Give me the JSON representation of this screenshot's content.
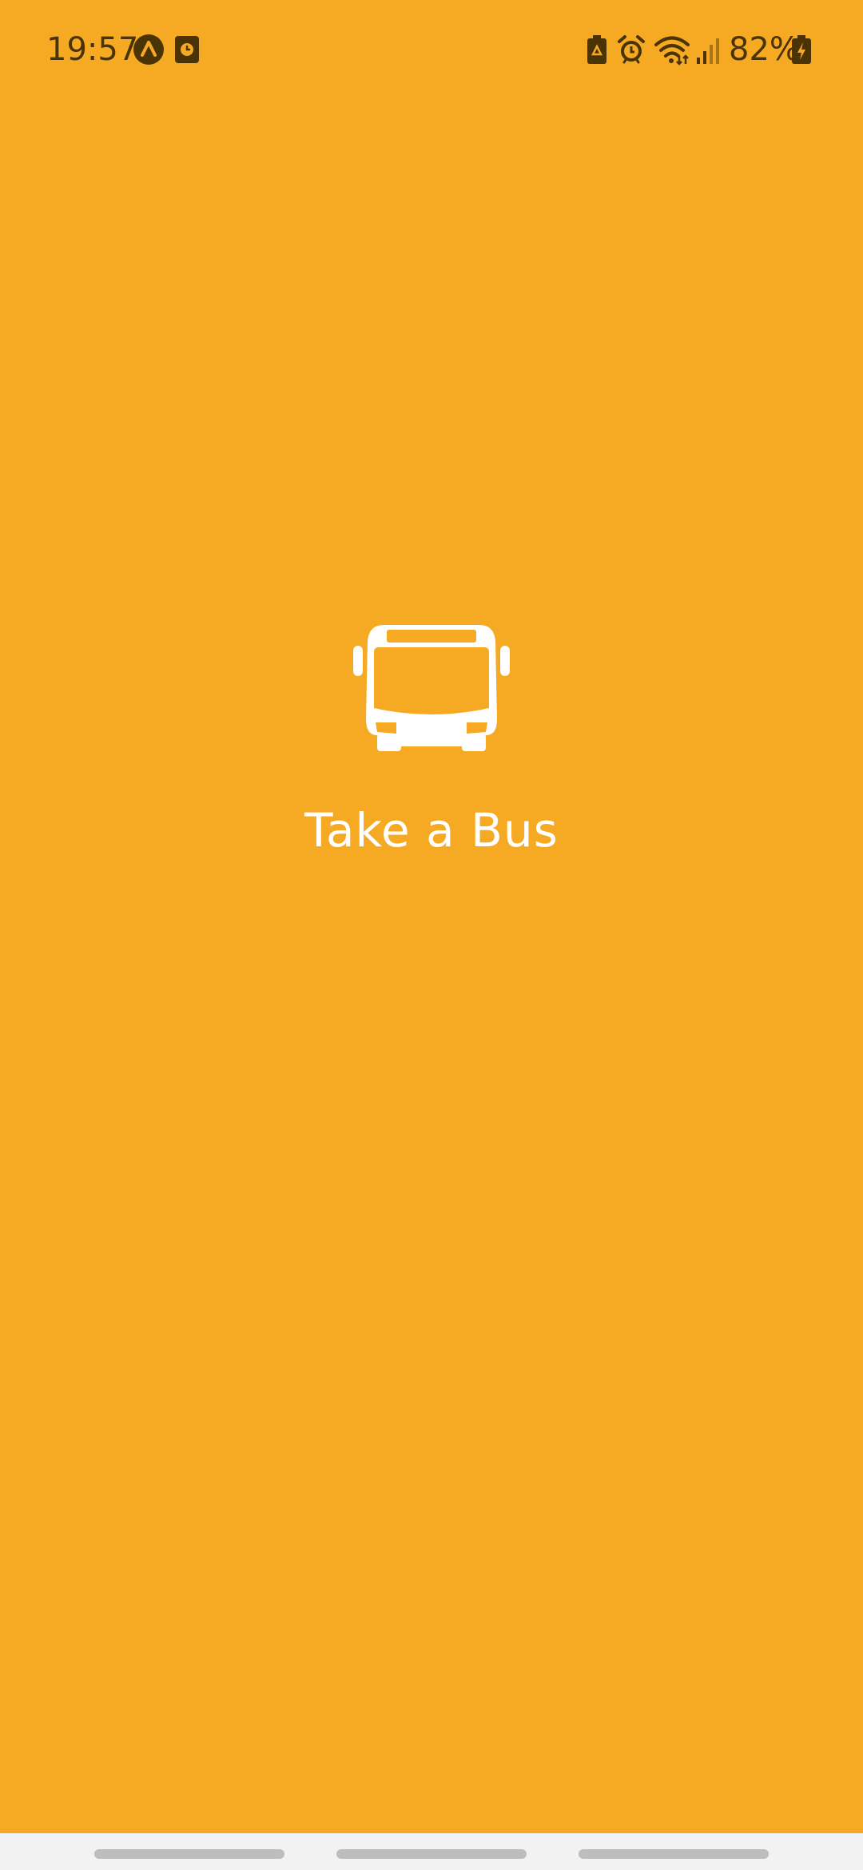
{
  "status_bar": {
    "time": "19:57",
    "battery_percent": "82%",
    "left_icons": [
      "navigation-app-icon",
      "clock-app-icon"
    ],
    "right_icons": [
      "battery-saver-icon",
      "alarm-icon",
      "wifi-icon",
      "signal-icon",
      "battery-charging-icon"
    ]
  },
  "splash": {
    "icon": "bus-icon",
    "app_name": "Take a Bus"
  },
  "colors": {
    "background": "#F6AA24",
    "foreground": "#FFFFFF",
    "status_text": "#4A3305",
    "nav_bar": "#F2F2F2"
  }
}
